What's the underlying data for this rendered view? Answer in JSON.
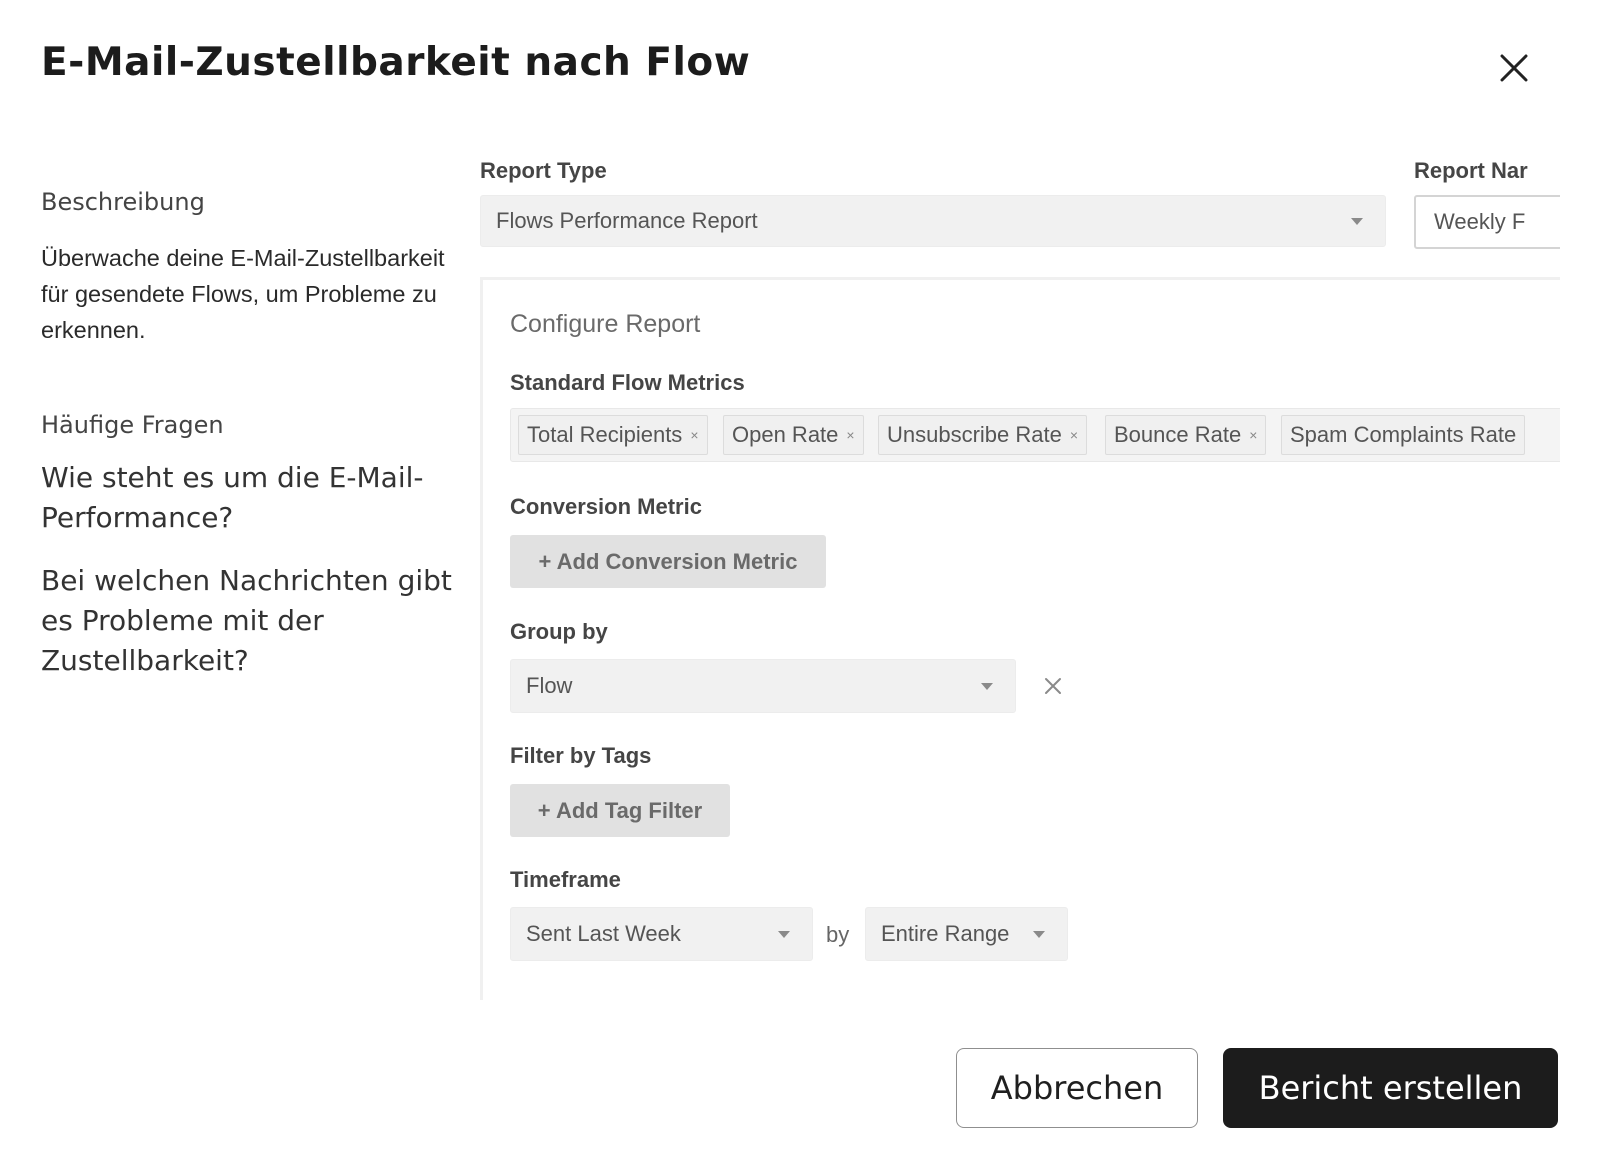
{
  "modal": {
    "title": "E-Mail-Zustellbarkeit nach Flow",
    "close_icon": "close-icon"
  },
  "sidebar": {
    "description_heading": "Beschreibung",
    "description_text": "Überwache deine E-Mail-Zustellbarkeit für gesendete Flows, um Probleme zu erkennen.",
    "faq_heading": "Häufige Fragen",
    "faq": [
      "Wie steht es um die E-Mail-Performance?",
      "Bei welchen Nachrichten gibt es Probleme mit der Zustellbarkeit?"
    ]
  },
  "form": {
    "report_type_label": "Report Type",
    "report_type_value": "Flows Performance Report",
    "report_name_label": "Report Nar",
    "report_name_value": "Weekly F",
    "configure_title": "Configure Report",
    "standard_metrics_label": "Standard Flow Metrics",
    "metrics": [
      "Total Recipients",
      "Open Rate",
      "Unsubscribe Rate",
      "Bounce Rate",
      "Spam Complaints Rate"
    ],
    "chip_remove": "×",
    "conversion_label": "Conversion Metric",
    "add_conversion": "+ Add Conversion Metric",
    "group_by_label": "Group by",
    "group_by_value": "Flow",
    "filter_tags_label": "Filter by Tags",
    "add_tag_filter": "+ Add Tag Filter",
    "timeframe_label": "Timeframe",
    "timeframe_value": "Sent Last Week",
    "by_text": "by",
    "range_value": "Entire Range"
  },
  "footer": {
    "cancel_label": "Abbrechen",
    "create_label": "Bericht erstellen"
  },
  "colors": {
    "primary_button": "#1c1c1c",
    "field_background": "#f1f1f1"
  }
}
